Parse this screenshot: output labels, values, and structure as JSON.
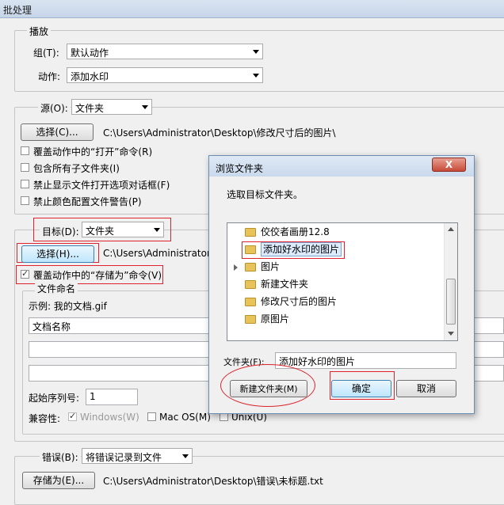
{
  "window": {
    "title": "批处理"
  },
  "play": {
    "legend": "播放",
    "group_label": "组(T):",
    "group_value": "默认动作",
    "action_label": "动作:",
    "action_value": "添加水印"
  },
  "source": {
    "label": "源(O):",
    "value": "文件夹",
    "choose_label": "选择(C)...",
    "path": "C:\\Users\\Administrator\\Desktop\\修改尺寸后的图片\\",
    "options": [
      {
        "label": "覆盖动作中的“打开”命令(R)",
        "checked": false
      },
      {
        "label": "包含所有子文件夹(I)",
        "checked": false
      },
      {
        "label": "禁止显示文件打开选项对话框(F)",
        "checked": false
      },
      {
        "label": "禁止颜色配置文件警告(P)",
        "checked": false
      }
    ]
  },
  "target": {
    "label": "目标(D):",
    "value": "文件夹",
    "choose_label": "选择(H)...",
    "path": "C:\\Users\\Administrator\\D",
    "override_label": "覆盖动作中的“存储为”命令(V)",
    "override_checked": true
  },
  "naming": {
    "legend": "文件命名",
    "example": "示例: 我的文档.gif",
    "field1": "文档名称",
    "field2": "",
    "field3": "",
    "serial_label": "起始序列号:",
    "serial_value": "1",
    "compat_label": "兼容性:",
    "compat_windows": "Windows(W)",
    "compat_mac": "Mac OS(M)",
    "compat_unix": "Unix(U)"
  },
  "errors": {
    "label": "错误(B):",
    "value": "将错误记录到文件",
    "saveas_label": "存储为(E)...",
    "path": "C:\\Users\\Administrator\\Desktop\\错误\\未标题.txt"
  },
  "browse_dialog": {
    "title": "浏览文件夹",
    "prompt": "选取目标文件夹。",
    "close_label": "X",
    "tree_items": [
      {
        "label": "佼佼者画册12.8",
        "selected": false,
        "expandable": false
      },
      {
        "label": "添加好水印的图片",
        "selected": true,
        "expandable": false
      },
      {
        "label": "图片",
        "selected": false,
        "expandable": true
      },
      {
        "label": "新建文件夹",
        "selected": false,
        "expandable": false
      },
      {
        "label": "修改尺寸后的图片",
        "selected": false,
        "expandable": false
      },
      {
        "label": "原图片",
        "selected": false,
        "expandable": false
      }
    ],
    "folder_label": "文件夹(F):",
    "folder_value": "添加好水印的图片",
    "new_folder_label": "新建文件夹(M)",
    "ok_label": "确定",
    "cancel_label": "取消"
  }
}
